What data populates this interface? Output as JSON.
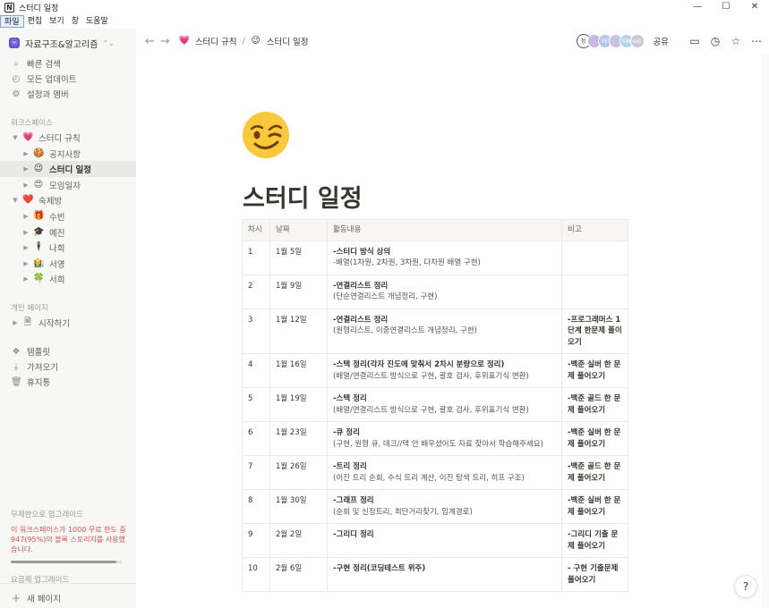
{
  "window": {
    "title": "스터디 일정",
    "min": "—",
    "max": "☐",
    "close": "✕"
  },
  "menu": [
    "파일",
    "편집",
    "보기",
    "창",
    "도움말"
  ],
  "sidebar": {
    "workspace": "자료구조&알고리즘",
    "workspace_logo": "ⓦ",
    "top": [
      {
        "icon": "search-icon",
        "glyph": "⌕",
        "label": "빠른 검색"
      },
      {
        "icon": "clock-icon",
        "glyph": "◴",
        "label": "모든 업데이트"
      },
      {
        "icon": "gear-icon",
        "glyph": "⚙",
        "label": "설정과 멤버"
      }
    ],
    "section_workspace": "워크스페이스",
    "tree": [
      {
        "level": 0,
        "caret": "▼",
        "emoji": "💗",
        "label": "스터디 규칙"
      },
      {
        "level": 1,
        "caret": "▶",
        "emoji": "🍪",
        "label": "공지사항"
      },
      {
        "level": 1,
        "caret": "▶",
        "emoji": "😉",
        "label": "스터디 일정",
        "selected": true
      },
      {
        "level": 1,
        "caret": "▶",
        "emoji": "😍",
        "label": "모임일자"
      },
      {
        "level": 0,
        "caret": "▼",
        "emoji": "❤️",
        "label": "숙제방"
      },
      {
        "level": 1,
        "caret": "▶",
        "emoji": "🎁",
        "label": "수빈"
      },
      {
        "level": 1,
        "caret": "▶",
        "emoji": "🎓",
        "label": "예진"
      },
      {
        "level": 1,
        "caret": "▶",
        "emoji": "🕴",
        "label": "나희"
      },
      {
        "level": 1,
        "caret": "▶",
        "emoji": "👩‍🌾",
        "label": "서영"
      },
      {
        "level": 1,
        "caret": "▶",
        "emoji": "🍀",
        "label": "서희"
      }
    ],
    "section_private": "개인 페이지",
    "private": [
      {
        "caret": "▶",
        "glyph": "🗎",
        "label": "시작하기"
      }
    ],
    "bottom": [
      {
        "icon": "template-icon",
        "glyph": "❖",
        "label": "템플릿"
      },
      {
        "icon": "import-icon",
        "glyph": "⤓",
        "label": "가져오기"
      },
      {
        "icon": "trash-icon",
        "glyph": "🗑",
        "label": "휴지통"
      }
    ],
    "upgrade": {
      "title": "무제한으로 업그레이드",
      "warning": "이 워크스페이스가 1000 무료 한도 중 947(95%)의 블록 스토리지를 사용했습니다.",
      "usage_fraction": 0.95,
      "link": "요금제 업그레이드"
    },
    "new_page": "새 페이지"
  },
  "topbar": {
    "crumbs": [
      {
        "emoji": "💗",
        "label": "스터디 규칙"
      },
      {
        "emoji": "😉",
        "label": "스터디 일정"
      }
    ],
    "separator": "/",
    "avatars": [
      {
        "text": "정",
        "color": "#ffffff",
        "fg": "#37352f"
      },
      {
        "text": "",
        "color": "#c9b6e8"
      },
      {
        "text": "YE",
        "color": "#b7c6ea"
      },
      {
        "text": "",
        "color": "#c7c4e0"
      },
      {
        "text": "SW",
        "color": "#b6d3e6"
      },
      {
        "text": "seh",
        "color": "#c9c7d9"
      }
    ],
    "share": "공유"
  },
  "page": {
    "emoji": "😉",
    "title": "스터디 일정",
    "table": {
      "headers": [
        "차시",
        "날짜",
        "활동내용",
        "비고"
      ],
      "rows": [
        {
          "no": "1",
          "date": "1월 5일",
          "act": "-스터디 방식 상의",
          "sub": "-배열(1차원, 2차원, 3차원, 다차원 배열 구현)",
          "note": ""
        },
        {
          "no": "2",
          "date": "1월 9일",
          "act": "-연결리스트 정리",
          "sub": "(단순연결리스트 개념정리, 구현)",
          "note": ""
        },
        {
          "no": "3",
          "date": "1월 12일",
          "act": "-연결리스트 정리",
          "sub": "(원형리스트, 이중연결리스트 개념정리, 구현)",
          "note": "-프로그래머스 1단계 한문제 풀이오기"
        },
        {
          "no": "4",
          "date": "1월 16일",
          "act": "-스택 정리(각자 진도에 맞춰서 2차시 분량으로 정리)",
          "sub": "(배열/연결리스트 방식으로 구현, 괄호 검사, 후위표기식 변환)",
          "note": "-백준 실버 한 문제 풀어오기"
        },
        {
          "no": "5",
          "date": "1월 19일",
          "act": "-스택 정리",
          "sub": "(배열/연결리스트 방식으로 구현, 괄호 검사, 후위표기식 변환)",
          "note": "-백준 골드 한 문제 풀어오기"
        },
        {
          "no": "6",
          "date": "1월 23일",
          "act": "-큐 정리",
          "sub": "(구현, 원형 큐, 데크//덱 안 배우셨어도 자료 찾아서 학습해주세요)",
          "note": "-백준 실버 한 문제 풀어오기"
        },
        {
          "no": "7",
          "date": "1월 26일",
          "act": "-트리 정리",
          "sub": "(이진 트리 순회, 수식 트리 계산, 이진 탐색 트리, 히프 구조)",
          "note": "-백준 골드 한 문제 풀어오기"
        },
        {
          "no": "8",
          "date": "1월 30일",
          "act": "-그래프 정리",
          "sub": "(순회 및 신장트리, 최단거리찾기, 임계경로)",
          "note": "-백준 실버 한 문제 풀어오기"
        },
        {
          "no": "9",
          "date": "2월 2일",
          "act": "-그리디 정리",
          "sub": "",
          "note": "-그리디 기출 문제 풀어오기"
        },
        {
          "no": "10",
          "date": "2월 6일",
          "act": "-구현 정리(코딩테스트 위주)",
          "sub": "",
          "note": "- 구현 기출문제 풀어오기"
        }
      ]
    }
  },
  "help": "?"
}
